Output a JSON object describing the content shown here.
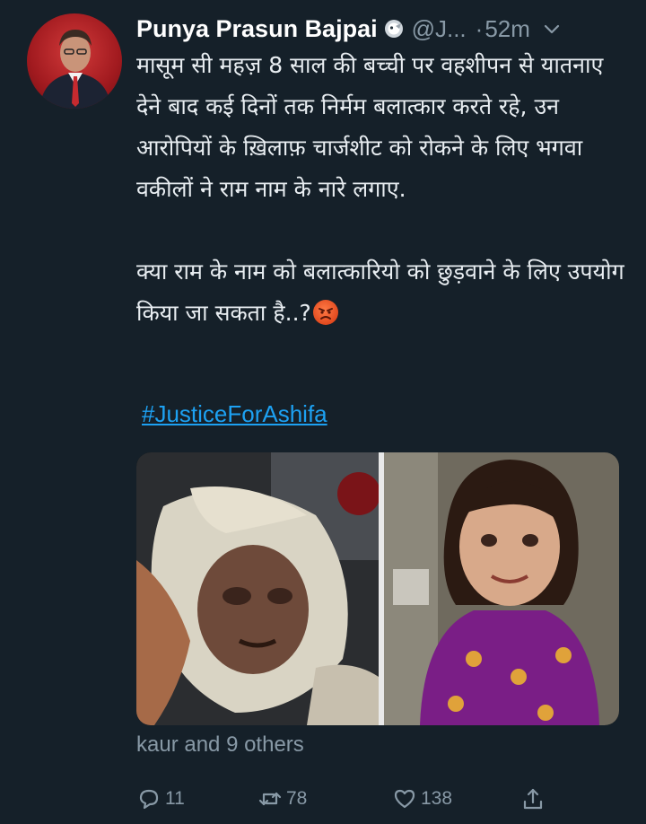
{
  "tweet": {
    "author_name": "Punya Prasun Bajpai",
    "handle": "@J...",
    "separator": "·",
    "time": "52m",
    "paragraphs": [
      "मासूम सी महज़ 8 साल की बच्ची पर वहशीपन से यातनाए देने बाद कई दिनों तक निर्मम बलात्कार करते रहे, उन आरोपियों के ख़िलाफ़ चार्जशीट को रोकने के लिए भगवा वकीलों ने राम नाम के नारे लगाए.",
      "क्या राम के नाम को बलात्कारियो को छुड़वाने के लिए उपयोग किया जा सकता है..?"
    ],
    "emoji": "angry-face",
    "hashtag": "#JusticeForAshifa",
    "liked_by": "kaur and 9 others",
    "actions": {
      "reply_count": "11",
      "retweet_count": "78",
      "like_count": "138"
    }
  },
  "icons": [
    "verified-icon",
    "chevron-down-icon",
    "reply-icon",
    "retweet-icon",
    "like-icon",
    "share-icon"
  ],
  "colors": {
    "background": "#152029",
    "text": "#e8edf1",
    "muted": "#8899a6",
    "link": "#1da1f2"
  }
}
